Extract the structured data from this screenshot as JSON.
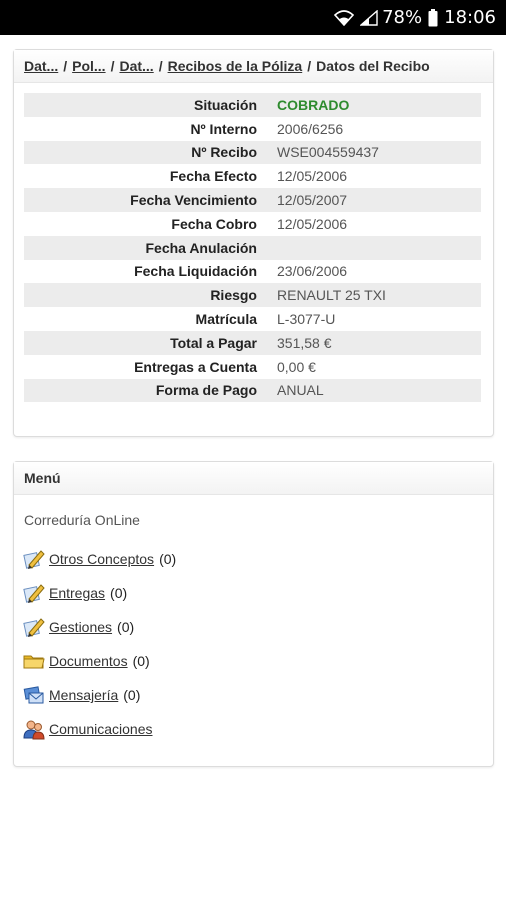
{
  "status_bar": {
    "battery": "78%",
    "time": "18:06"
  },
  "breadcrumb": [
    {
      "label": "Dat..."
    },
    {
      "label": "Pol..."
    },
    {
      "label": "Dat..."
    },
    {
      "label": "Recibos de la Póliza"
    },
    {
      "label": "Datos del Recibo"
    }
  ],
  "receipt": {
    "rows": [
      {
        "label": "Situación",
        "value": "COBRADO"
      },
      {
        "label": "Nº Interno",
        "value": "2006/6256"
      },
      {
        "label": "Nº Recibo",
        "value": "WSE004559437"
      },
      {
        "label": "Fecha Efecto",
        "value": "12/05/2006"
      },
      {
        "label": "Fecha Vencimiento",
        "value": "12/05/2007"
      },
      {
        "label": "Fecha Cobro",
        "value": "12/05/2006"
      },
      {
        "label": "Fecha Anulación",
        "value": ""
      },
      {
        "label": "Fecha Liquidación",
        "value": "23/06/2006"
      },
      {
        "label": "Riesgo",
        "value": "RENAULT 25 TXI"
      },
      {
        "label": "Matrícula",
        "value": "L-3077-U"
      },
      {
        "label": "Total a Pagar",
        "value": "351,58 €"
      },
      {
        "label": "Entregas a Cuenta",
        "value": "0,00 €"
      },
      {
        "label": "Forma de Pago",
        "value": "ANUAL"
      }
    ],
    "status_color": "#2e8b2e"
  },
  "menu": {
    "title": "Menú",
    "subtitle": "Correduría OnLine",
    "items": [
      {
        "label": "Otros Conceptos",
        "count": "(0)",
        "icon": "pencil-note-icon"
      },
      {
        "label": "Entregas",
        "count": "(0)",
        "icon": "pencil-note-icon"
      },
      {
        "label": "Gestiones",
        "count": "(0)",
        "icon": "pencil-note-icon"
      },
      {
        "label": "Documentos",
        "count": "(0)",
        "icon": "folder-icon"
      },
      {
        "label": "Mensajería",
        "count": "(0)",
        "icon": "messages-icon"
      },
      {
        "label": "Comunicaciones",
        "count": "",
        "icon": "users-icon"
      }
    ]
  }
}
